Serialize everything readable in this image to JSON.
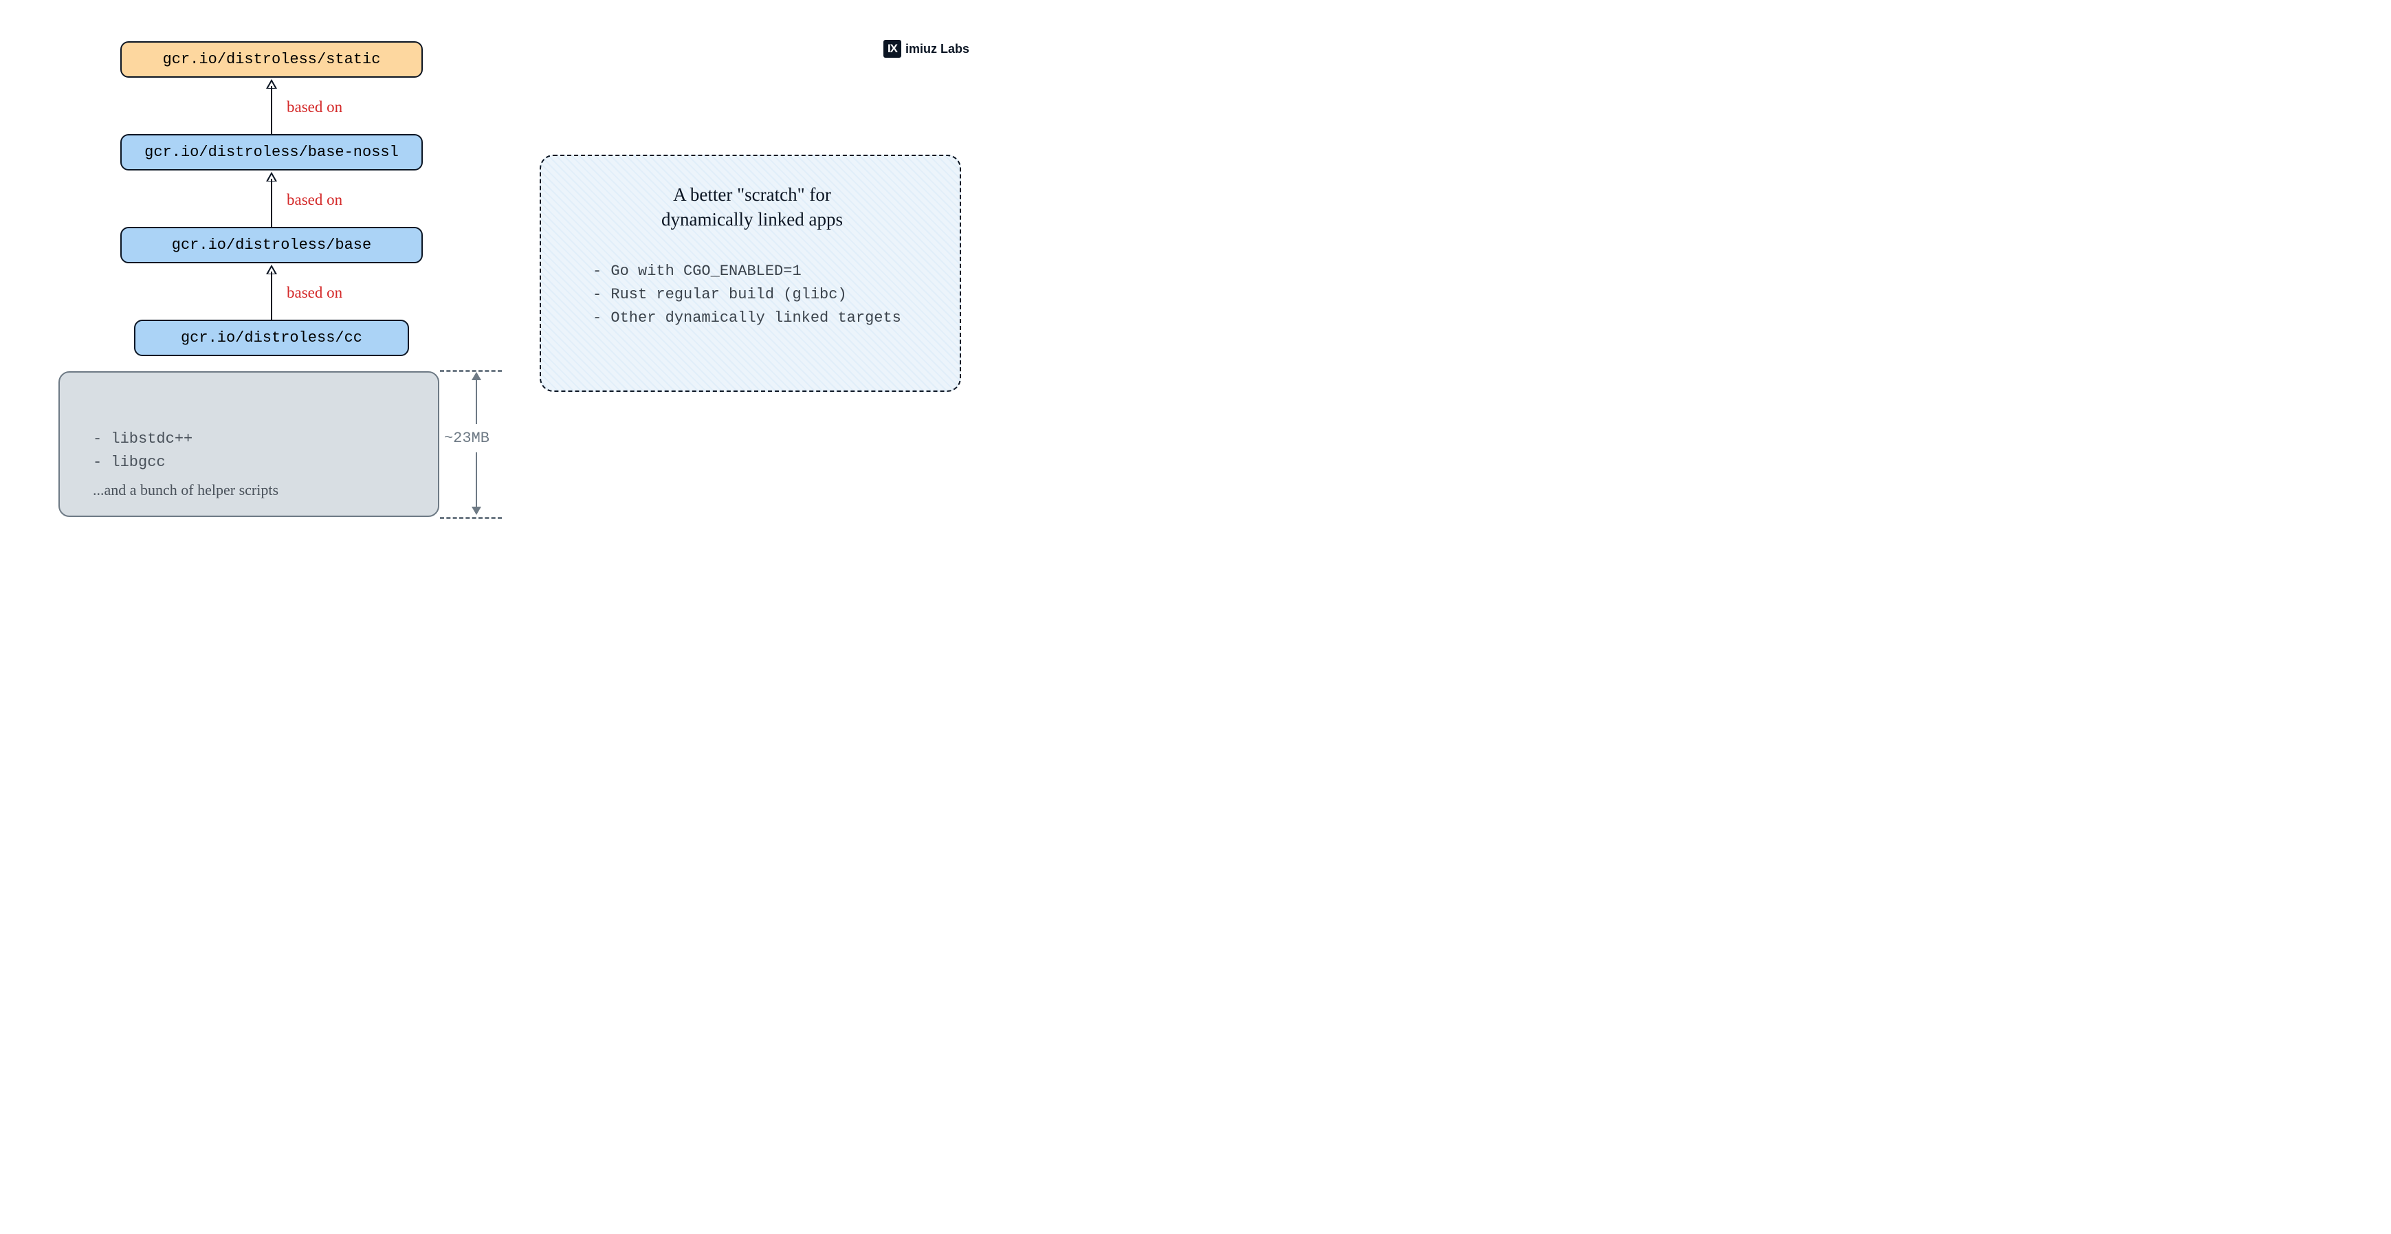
{
  "logo": {
    "icon": "IX",
    "text": "imiuz Labs"
  },
  "nodes": {
    "static": "gcr.io/distroless/static",
    "base_nossl": "gcr.io/distroless/base-nossl",
    "base": "gcr.io/distroless/base",
    "cc": "gcr.io/distroless/cc"
  },
  "edge_label": "based on",
  "bottom": {
    "items": [
      "libstdc++",
      "libgcc"
    ],
    "extra": "...and a bunch of helper scripts"
  },
  "size_label": "~23MB",
  "note": {
    "title_l1": "A better \"scratch\" for",
    "title_l2": "dynamically linked apps",
    "items": [
      "Go with CGO_ENABLED=1",
      "Rust regular build (glibc)",
      "Other dynamically linked targets"
    ]
  }
}
